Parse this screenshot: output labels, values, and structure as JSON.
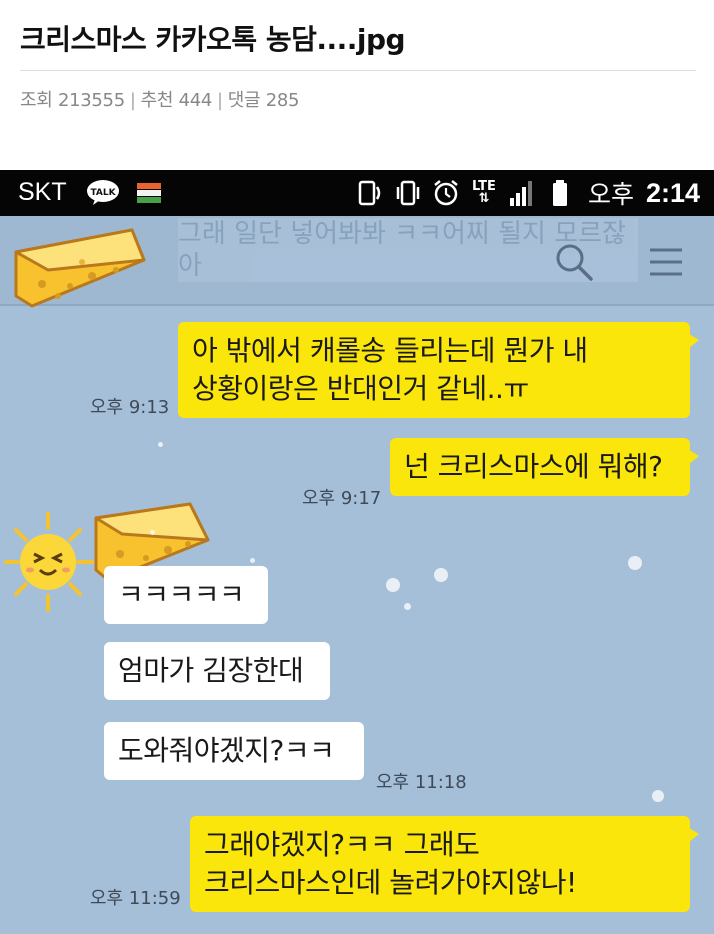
{
  "post": {
    "title": "크리스마스 카카오톡 농담....jpg",
    "views_label": "조회 213555",
    "recommend_label": "추천 444",
    "comments_label": "댓글 285",
    "separator": "|"
  },
  "status_bar": {
    "carrier": "SKT",
    "talk_badge": "TALK",
    "lte": "LTE",
    "ampm": "오후",
    "time": "2:14"
  },
  "chat_header": {
    "notice": "그래 일단 넣어봐봐 ㅋㅋ어찌 될지 모르잖아",
    "search_icon": "search-icon",
    "menu_icon": "menu-icon"
  },
  "messages": [
    {
      "sender": "me",
      "lines": [
        "아 밖에서 캐롤송 들리는데 뭔가 내",
        "상황이랑은 반대인거 같네..ㅠ"
      ],
      "time": "오후 9:13"
    },
    {
      "sender": "me",
      "lines": [
        "넌 크리스마스에 뭐해?"
      ],
      "time": "오후 9:17"
    },
    {
      "sender": "them",
      "lines": [
        "ㅋㅋㅋㅋㅋ"
      ],
      "time": ""
    },
    {
      "sender": "them",
      "lines": [
        "엄마가 김장한대"
      ],
      "time": ""
    },
    {
      "sender": "them",
      "lines": [
        "도와줘야겠지?ㅋㅋ"
      ],
      "time": "오후 11:18"
    },
    {
      "sender": "me",
      "lines": [
        "그래야겠지?ㅋㅋ 그래도",
        "크리스마스인데 놀려가야지않나!"
      ],
      "time": "오후 11:59"
    }
  ],
  "colors": {
    "chat_bg": "#a6bfd8",
    "my_bubble": "#fbe60b",
    "their_bubble": "#ffffff",
    "status_bar": "#050505"
  }
}
